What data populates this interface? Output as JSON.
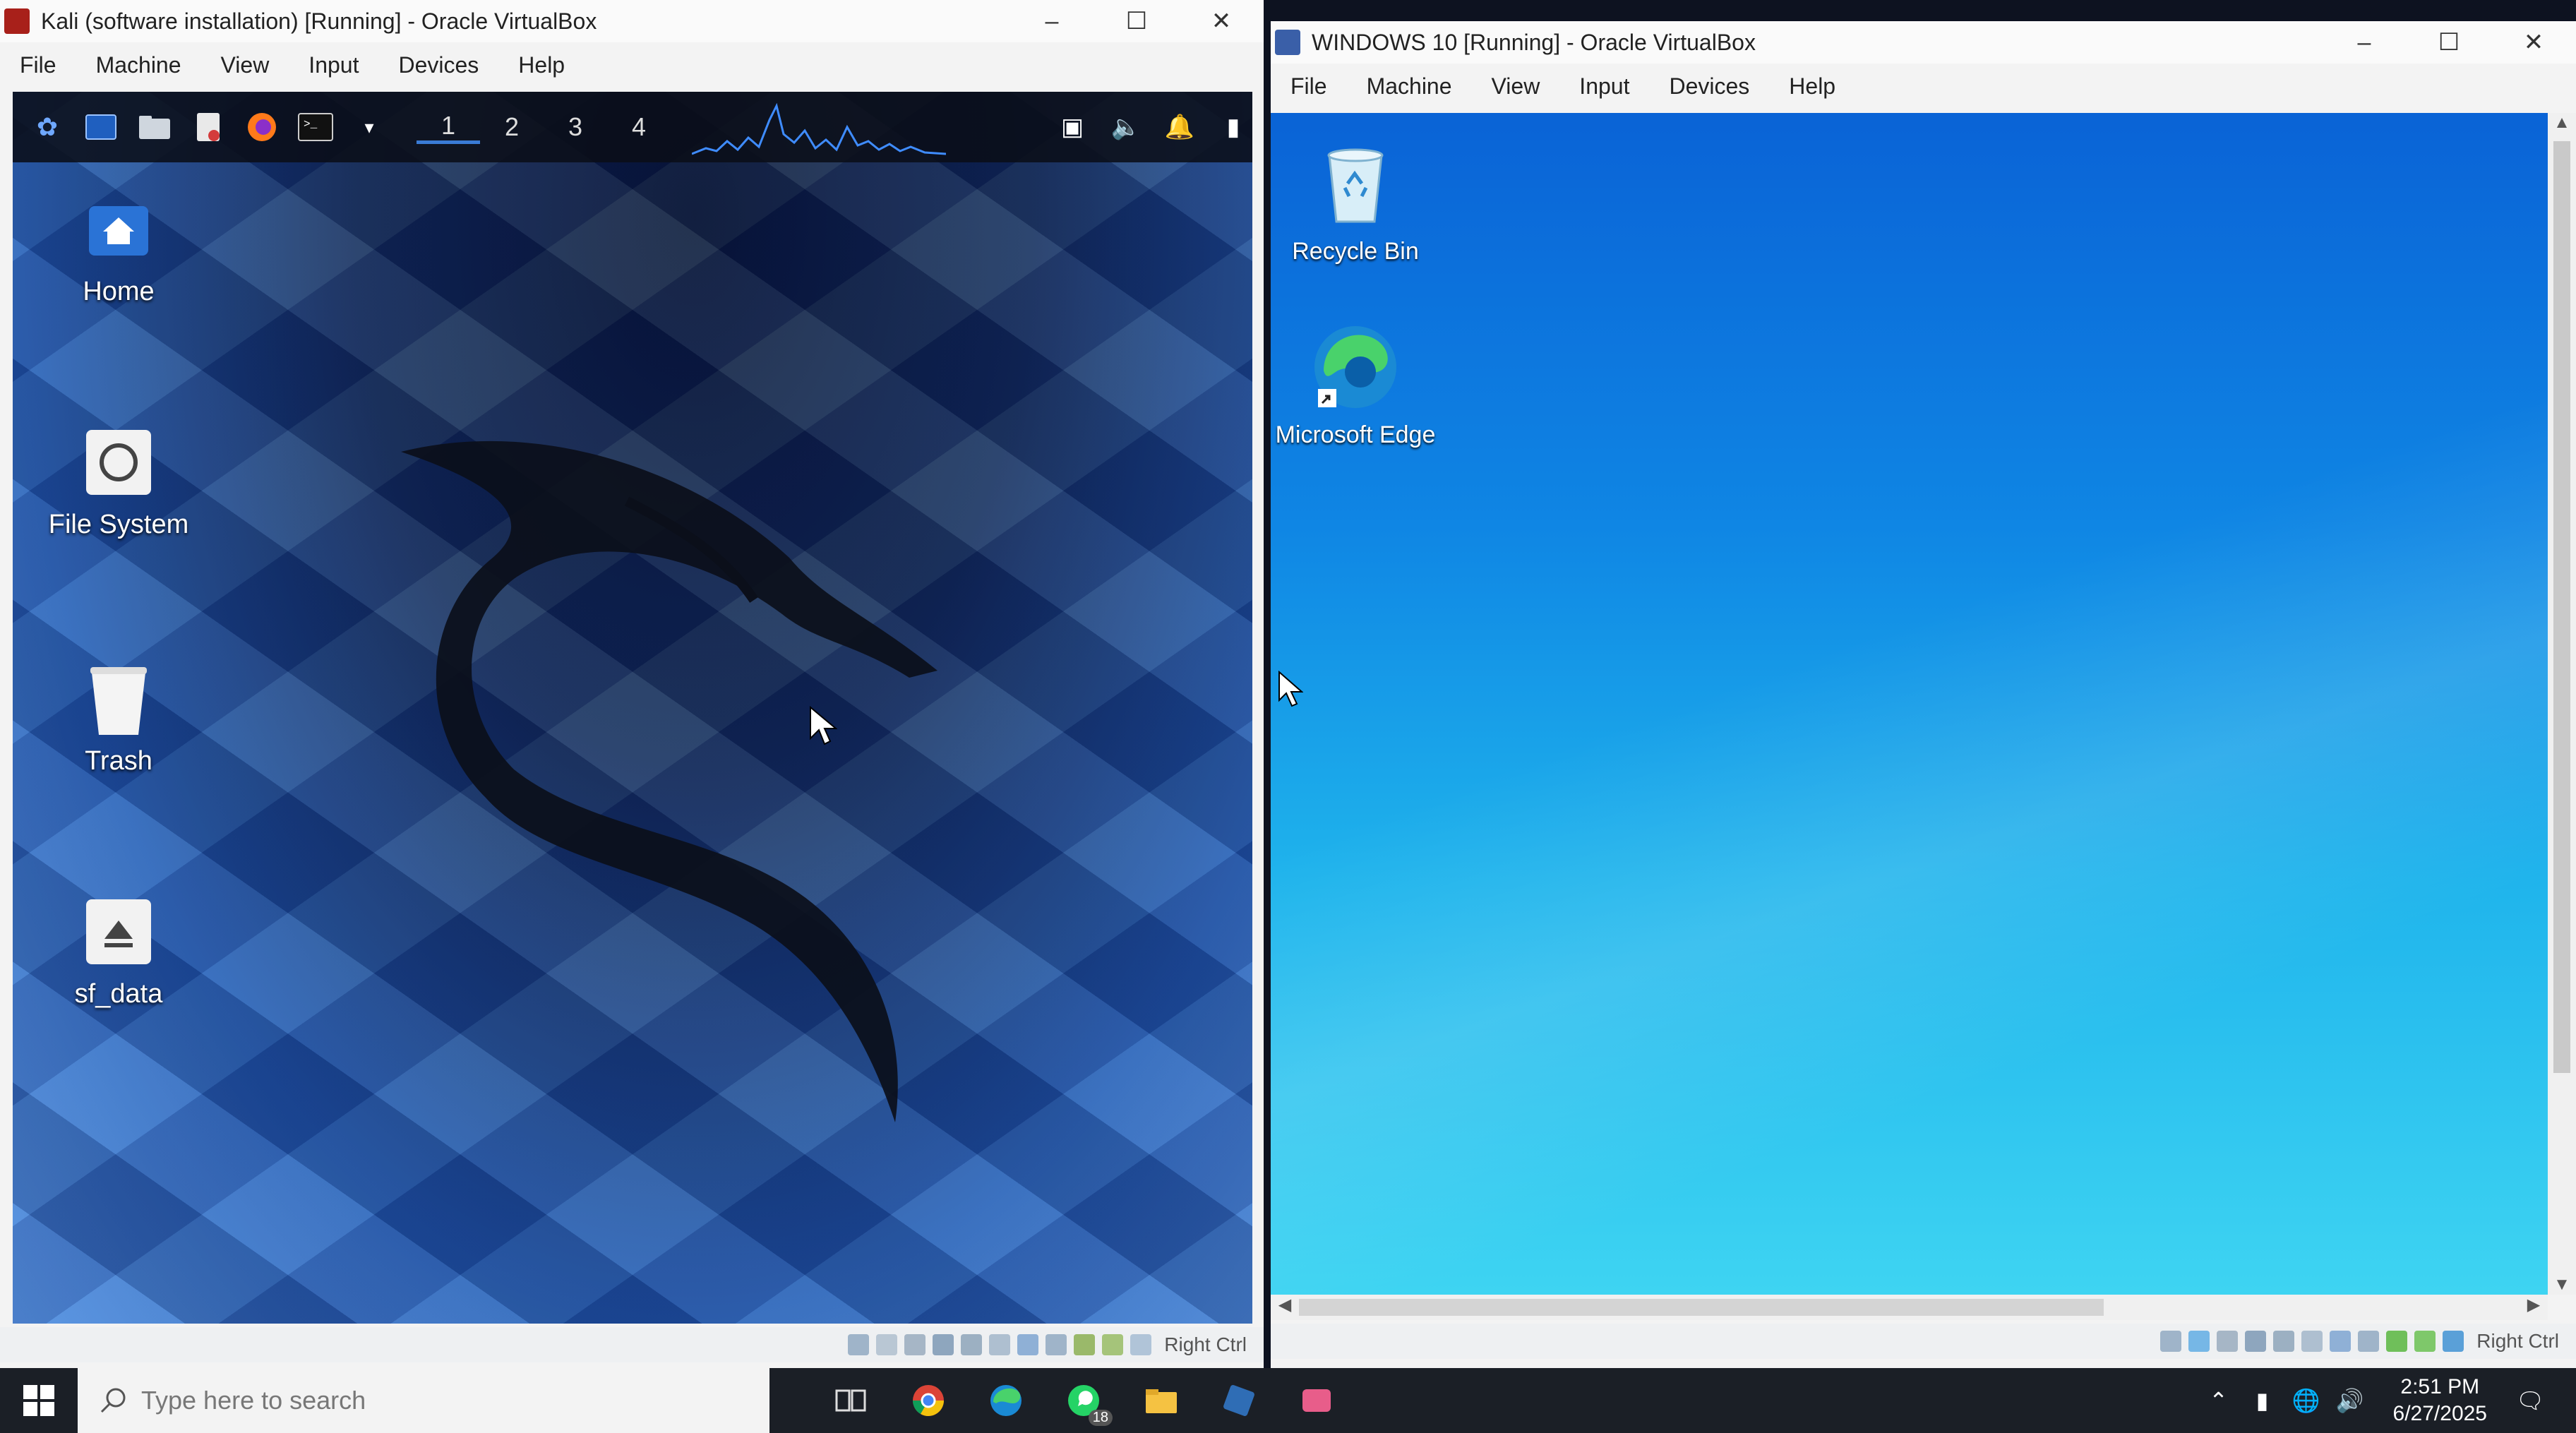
{
  "kali_window": {
    "title": "Kali (software installation) [Running] - Oracle VirtualBox",
    "menu": [
      "File",
      "Machine",
      "View",
      "Input",
      "Devices",
      "Help"
    ],
    "workspaces": [
      "1",
      "2",
      "3",
      "4"
    ],
    "desktop_icons": [
      {
        "label": "Home",
        "icon": "home-icon"
      },
      {
        "label": "File System",
        "icon": "drive-icon"
      },
      {
        "label": "Trash",
        "icon": "trash-icon"
      },
      {
        "label": "sf_data",
        "icon": "eject-icon"
      }
    ],
    "host_key": "Right Ctrl"
  },
  "win10_window": {
    "title": "WINDOWS 10 [Running] - Oracle VirtualBox",
    "menu": [
      "File",
      "Machine",
      "View",
      "Input",
      "Devices",
      "Help"
    ],
    "desktop_icons": [
      {
        "label": "Recycle Bin",
        "icon": "recycle-bin-icon"
      },
      {
        "label": "Microsoft Edge",
        "icon": "edge-icon"
      }
    ],
    "host_key": "Right Ctrl"
  },
  "taskbar": {
    "search_placeholder": "Type here to search",
    "badge": "18",
    "time": "2:51 PM",
    "date": "6/27/2025"
  },
  "colors": {
    "kali_blue": "#2460b8",
    "win10_blue": "#1fb4ec",
    "taskbar": "#1b1f26"
  }
}
